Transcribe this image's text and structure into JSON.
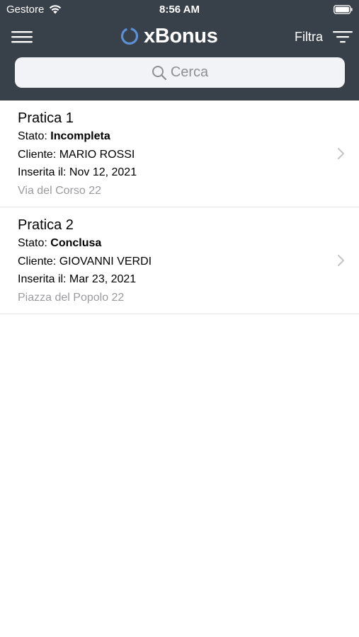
{
  "status_bar": {
    "carrier": "Gestore",
    "time": "8:56 AM",
    "wifi_icon": "wifi-icon",
    "battery_icon": "battery-icon"
  },
  "nav": {
    "app_name": "xBonus",
    "filter_label": "Filtra",
    "menu_icon": "hamburger-menu-icon",
    "filter_icon": "filter-icon",
    "logo_icon": "ring-logo-icon"
  },
  "search": {
    "placeholder": "Cerca"
  },
  "colors": {
    "header_bg": "#38404a",
    "logo_accent": "#5b8fd6",
    "secondary_text": "#9b9b9f"
  },
  "list": {
    "items": [
      {
        "title": "Pratica 1",
        "status_label": "Stato:",
        "status_value": "Incompleta",
        "client": "Cliente: MARIO ROSSI",
        "date": "Inserita il: Nov 12, 2021",
        "address": "Via del Corso 22"
      },
      {
        "title": "Pratica 2",
        "status_label": "Stato:",
        "status_value": "Conclusa",
        "client": "Cliente: GIOVANNI VERDI",
        "date": "Inserita il: Mar 23, 2021",
        "address": "Piazza del Popolo 22"
      }
    ]
  }
}
